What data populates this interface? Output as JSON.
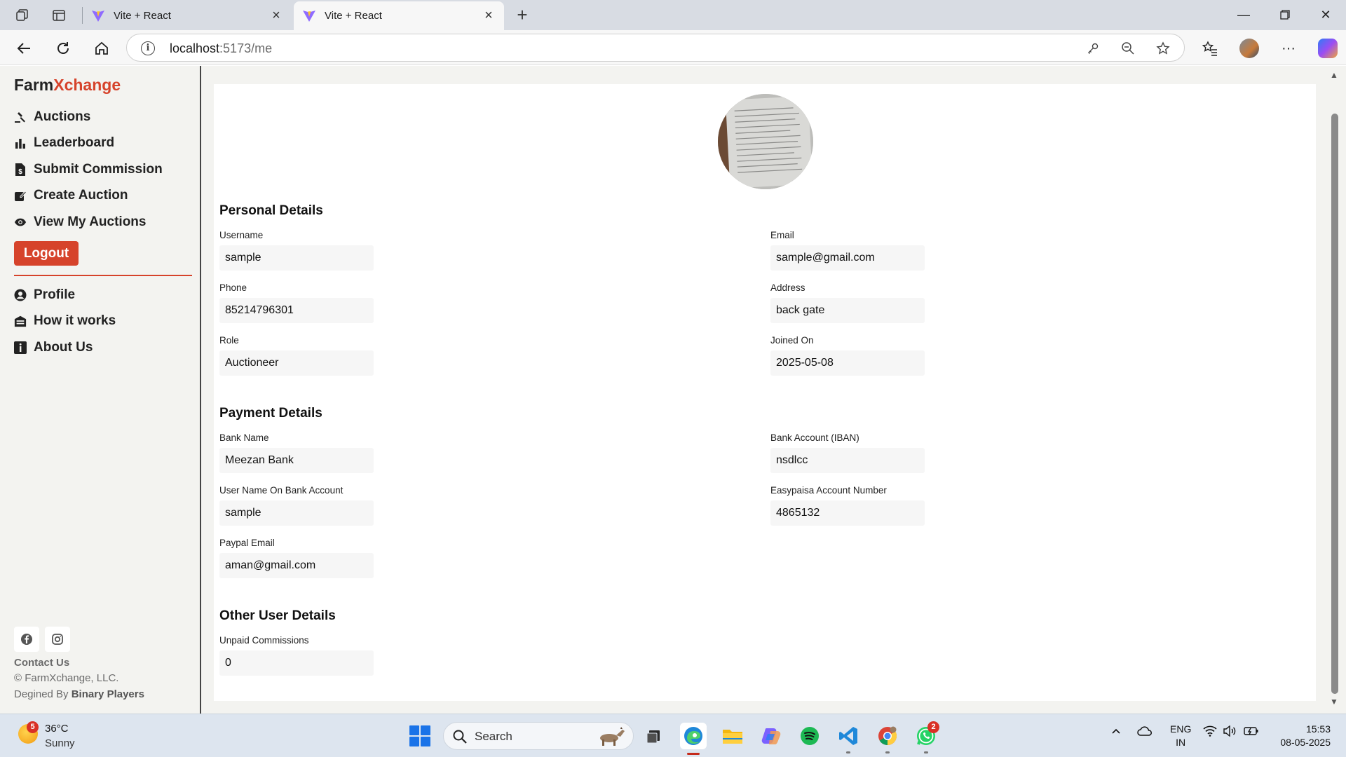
{
  "browser": {
    "tabs": [
      {
        "title": "Vite + React"
      },
      {
        "title": "Vite + React"
      }
    ],
    "url_host": "localhost",
    "url_path": ":5173/me"
  },
  "sidebar": {
    "brand_part1": "Farm",
    "brand_part2": "Xchange",
    "nav": [
      {
        "label": "Auctions",
        "icon": "gavel-icon"
      },
      {
        "label": "Leaderboard",
        "icon": "bar-chart-icon"
      },
      {
        "label": "Submit Commission",
        "icon": "dollar-file-icon"
      },
      {
        "label": "Create Auction",
        "icon": "edit-icon"
      },
      {
        "label": "View My Auctions",
        "icon": "eye-icon"
      }
    ],
    "logout_label": "Logout",
    "nav2": [
      {
        "label": "Profile",
        "icon": "user-circle-icon"
      },
      {
        "label": "How it works",
        "icon": "garage-icon"
      },
      {
        "label": "About Us",
        "icon": "info-icon"
      }
    ],
    "contact_label": "Contact Us",
    "copyright": "© FarmXchange, LLC.",
    "designed_prefix": "Degined By ",
    "designed_by": "Binary Players"
  },
  "profile": {
    "personal_title": "Personal Details",
    "personal": [
      {
        "label": "Username",
        "value": "sample"
      },
      {
        "label": "Email",
        "value": "sample@gmail.com"
      },
      {
        "label": "Phone",
        "value": "85214796301"
      },
      {
        "label": "Address",
        "value": "back gate"
      },
      {
        "label": "Role",
        "value": "Auctioneer"
      },
      {
        "label": "Joined On",
        "value": "2025-05-08"
      }
    ],
    "payment_title": "Payment Details",
    "payment": [
      {
        "label": "Bank Name",
        "value": "Meezan Bank"
      },
      {
        "label": "Bank Account (IBAN)",
        "value": "nsdlcc"
      },
      {
        "label": "User Name On Bank Account",
        "value": "sample"
      },
      {
        "label": "Easypaisa Account Number",
        "value": "4865132"
      },
      {
        "label": "Paypal Email",
        "value": "aman@gmail.com"
      }
    ],
    "other_title": "Other User Details",
    "other": [
      {
        "label": "Unpaid Commissions",
        "value": "0"
      }
    ]
  },
  "taskbar": {
    "weather_badge": "5",
    "temperature": "36°C",
    "condition": "Sunny",
    "search_label": "Search",
    "whatsapp_badge": "2",
    "lang_line1": "ENG",
    "lang_line2": "IN",
    "time": "15:53",
    "date": "08-05-2025"
  },
  "colors": {
    "accent": "#d6432b",
    "sidebar_bg": "#f3f3f0",
    "field_bg": "#f6f6f6"
  }
}
